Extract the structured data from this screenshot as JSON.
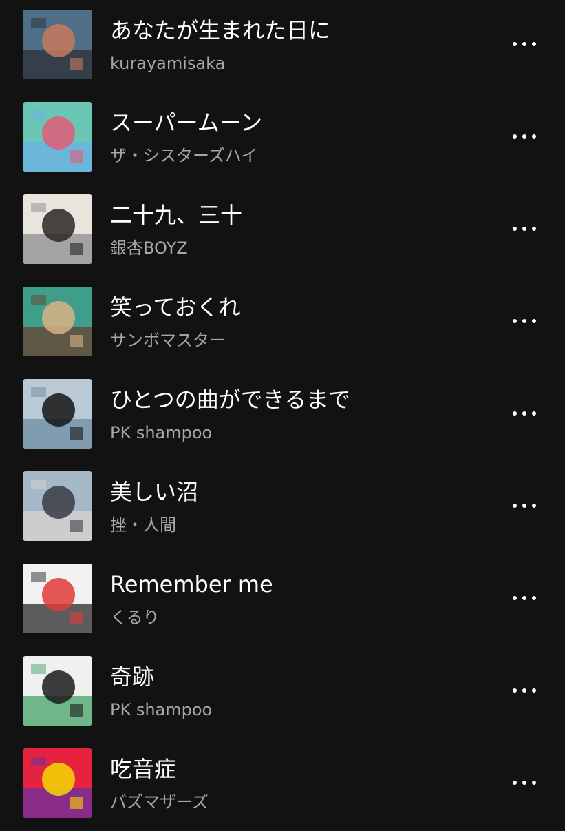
{
  "colors": {
    "background": "#121212",
    "title_text": "#ffffff",
    "artist_text": "#a7a7a7"
  },
  "tracks": [
    {
      "title": "あなたが生まれた日に",
      "artist": "kurayamisaka",
      "art_colors": [
        "#4f6f86",
        "#c67a5d",
        "#2b2f35"
      ]
    },
    {
      "title": "スーパームーン",
      "artist": "ザ・シスターズハイ",
      "art_colors": [
        "#69c7b4",
        "#e25c78",
        "#6fb0e8"
      ]
    },
    {
      "title": "二十九、三十",
      "artist": "銀杏BOYZ",
      "art_colors": [
        "#e9e5dc",
        "#2a2724",
        "#8a8c8f"
      ]
    },
    {
      "title": "笑っておくれ",
      "artist": "サンボマスター",
      "art_colors": [
        "#3f9e8a",
        "#d8b184",
        "#6c4030"
      ]
    },
    {
      "title": "ひとつの曲ができるまで",
      "artist": "PK shampoo",
      "art_colors": [
        "#b9c9d6",
        "#151515",
        "#6d8ca3"
      ]
    },
    {
      "title": "美しい沼",
      "artist": "挫・人間",
      "art_colors": [
        "#a4b8c8",
        "#3a3b44",
        "#d9d4cf"
      ]
    },
    {
      "title": "Remember me",
      "artist": "くるり",
      "art_colors": [
        "#f2f2f2",
        "#df3b3b",
        "#2a2a2a"
      ]
    },
    {
      "title": "奇跡",
      "artist": "PK shampoo",
      "art_colors": [
        "#f0f0f0",
        "#1b1b1b",
        "#46a36a"
      ]
    },
    {
      "title": "吃音症",
      "artist": "バズマザーズ",
      "art_colors": [
        "#e5233e",
        "#f5d900",
        "#6a2fa1"
      ]
    }
  ],
  "more_icon": "more-horizontal-icon"
}
